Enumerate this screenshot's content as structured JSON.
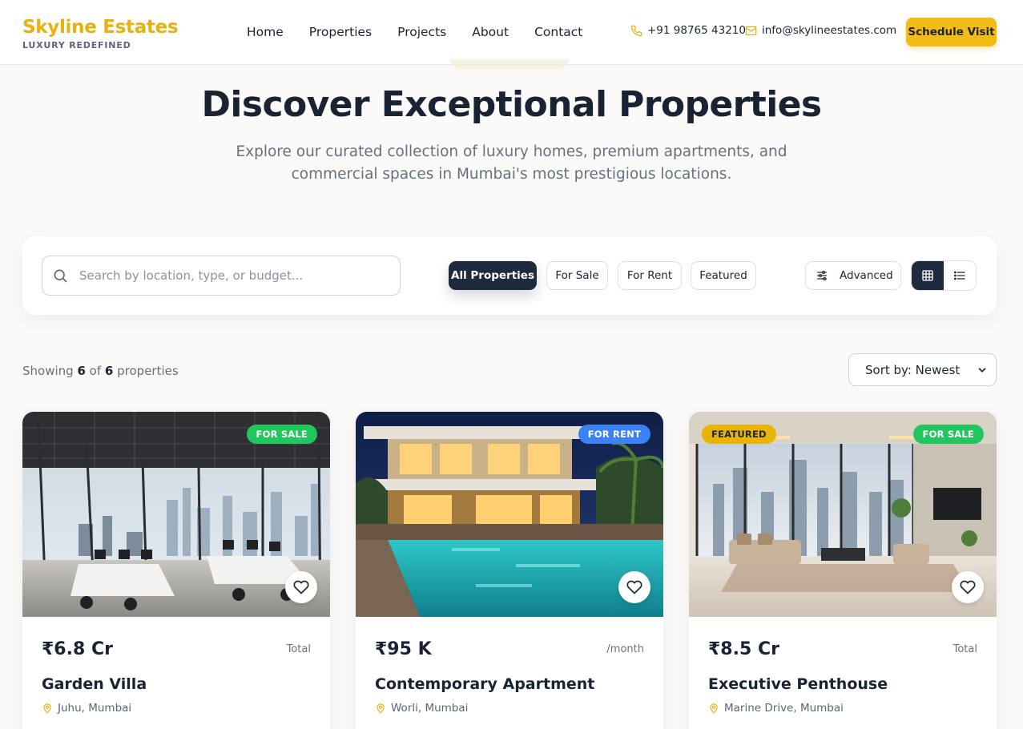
{
  "brand": {
    "name": "Skyline Estates",
    "tagline": "LUXURY REDEFINED"
  },
  "nav": {
    "items": [
      "Home",
      "Properties",
      "Projects",
      "About",
      "Contact"
    ]
  },
  "contact": {
    "phone": "+91 98765 43210",
    "email": "info@skylineestates.com"
  },
  "cta": {
    "label": "Schedule Visit"
  },
  "hero": {
    "title": "Discover Exceptional Properties",
    "subtitle": "Explore our curated collection of luxury homes, premium apartments, and commercial spaces in Mumbai's most prestigious locations."
  },
  "filters": {
    "search_placeholder": "Search by location, type, or budget...",
    "chips": [
      "All Properties",
      "For Sale",
      "For Rent",
      "Featured"
    ],
    "active_chip": "All Properties",
    "advanced_label": "Advanced",
    "view_mode": "grid"
  },
  "results": {
    "prefix": "Showing",
    "shown": "6",
    "of": "of",
    "total": "6",
    "suffix": "properties"
  },
  "sort": {
    "label": "Sort by: Newest"
  },
  "listings": [
    {
      "badges": [
        "FOR SALE"
      ],
      "price": "₹6.8 Cr",
      "unit": "Total",
      "title": "Garden Villa",
      "location": "Juhu, Mumbai"
    },
    {
      "badges": [
        "FOR RENT"
      ],
      "price": "₹95 K",
      "unit": "/month",
      "title": "Contemporary Apartment",
      "location": "Worli, Mumbai"
    },
    {
      "badges": [
        "FEATURED",
        "FOR SALE"
      ],
      "price": "₹8.5 Cr",
      "unit": "Total",
      "title": "Executive Penthouse",
      "location": "Marine Drive, Mumbai"
    }
  ],
  "colors": {
    "accent": "#f2bb15",
    "dark": "#1f2a3c",
    "sale": "#22c55e",
    "rent": "#3b82f6",
    "featured": "#eab308"
  },
  "icons": {
    "phone": "phone-icon",
    "email": "mail-icon",
    "search": "search-icon",
    "advanced": "sliders-icon",
    "grid": "grid-icon",
    "list": "list-icon",
    "favorite": "heart-icon",
    "location": "map-pin-icon",
    "sort": "chevron-down-icon"
  }
}
